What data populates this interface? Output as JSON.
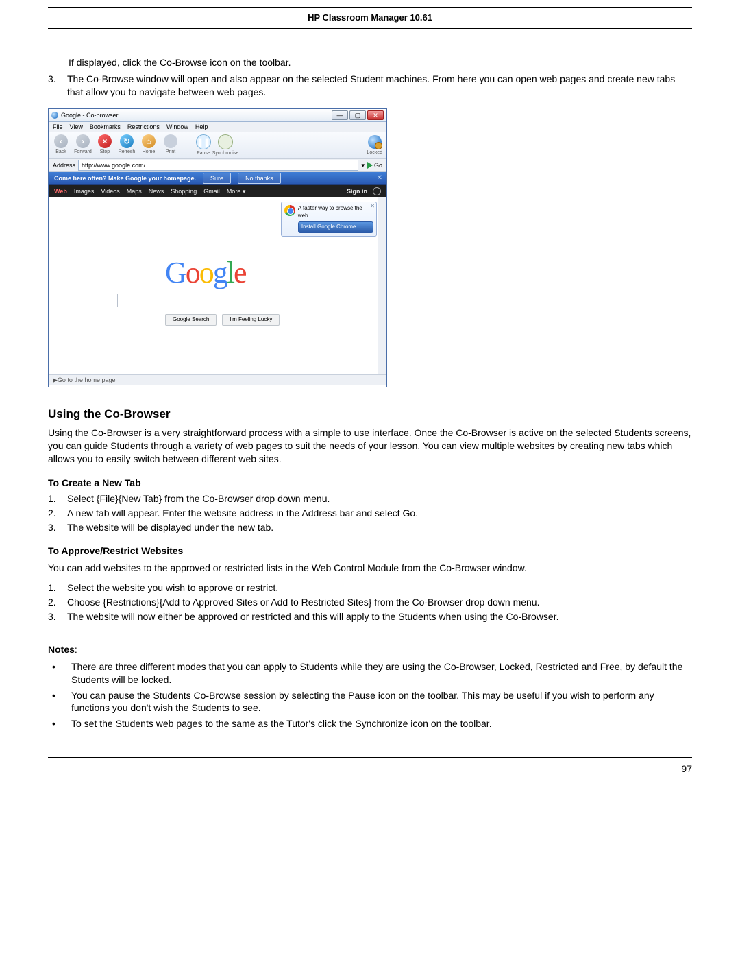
{
  "header": {
    "title": "HP Classroom Manager 10.61"
  },
  "intro": {
    "paragraph": "If displayed, click the Co-Browse icon on the toolbar.",
    "bullet3_num": "3.",
    "bullet3": "The Co-Browse window will open and also appear on the selected Student machines. From here you can open web pages and create new tabs that allow you to navigate between web pages."
  },
  "screenshot": {
    "window_title": "Google - Co-browser",
    "menu": [
      "File",
      "View",
      "Bookmarks",
      "Restrictions",
      "Window",
      "Help"
    ],
    "toolbar": [
      {
        "label": "Back",
        "id": "back",
        "sym": "‹"
      },
      {
        "label": "Forward",
        "id": "fwd",
        "sym": "›"
      },
      {
        "label": "Stop",
        "id": "stop",
        "sym": "×"
      },
      {
        "label": "Refresh",
        "id": "refresh",
        "sym": "↻"
      },
      {
        "label": "Home",
        "id": "home",
        "sym": "⌂"
      },
      {
        "label": "Print",
        "id": "print",
        "sym": ""
      },
      {
        "label": "Pause",
        "id": "pause",
        "sym": "❚❚"
      },
      {
        "label": "Synchronise",
        "id": "sync",
        "sym": ""
      }
    ],
    "toolbar_right_label": "Locked",
    "address_label": "Address",
    "address_value": "http://www.google.com/",
    "go_label": "Go",
    "bluebar_text": "Come here often? Make Google your homepage.",
    "bluebar_btn_sure": "Sure",
    "bluebar_btn_no": "No thanks",
    "blackbar_left": [
      "Web",
      "Images",
      "Videos",
      "Maps",
      "News",
      "Shopping",
      "Gmail",
      "More ▾"
    ],
    "blackbar_signin": "Sign in",
    "toast_text": "A faster way to browse the web",
    "toast_button": "Install Google Chrome",
    "google_letters": [
      "G",
      "o",
      "o",
      "g",
      "l",
      "e"
    ],
    "search_btn": "Google Search",
    "lucky_btn": "I'm Feeling Lucky",
    "status_text": "▶Go to the home page"
  },
  "sections": {
    "using_heading": "Using the Co-Browser",
    "using_text": "Using the Co-Browser is a very straightforward process with a simple to use interface. Once the Co-Browser is active on the selected Students screens, you can guide Students through a variety of web pages to suit the needs of your lesson. You can view multiple websites by creating new tabs which allows you to easily switch between different web sites.",
    "newtab_heading": "To Create a New Tab",
    "newtab_list": [
      "Select {File}{New Tab} from the Co-Browser drop down menu.",
      "A new tab will appear. Enter the website address in the Address bar and select Go.",
      "The website will be displayed under the new tab."
    ],
    "restrict_heading": "To Approve/Restrict Websites",
    "restrict_text": "You can add websites to the approved or restricted lists in the Web Control Module from the Co-Browser window.",
    "restrict_list": [
      "Select the website you wish to approve or restrict.",
      "Choose {Restrictions}{Add to Approved Sites or Add to Restricted Sites} from the Co-Browser drop down menu.",
      "The website will now either be approved or restricted and this will apply to the Students when using the Co-Browser."
    ],
    "notes_heading": "Notes",
    "notes_colon": ":",
    "notes_list": [
      "There are three different modes that you can apply to Students while they are using the Co-Browser, Locked, Restricted and Free, by default the Students will be locked.",
      "You can pause the Students Co-Browse session by selecting the Pause icon on the toolbar. This may be useful if you wish to perform any functions you don't wish the Students to see.",
      "To set the Students web pages to the same as the Tutor's click the Synchronize icon on the toolbar."
    ]
  },
  "page_number": "97"
}
